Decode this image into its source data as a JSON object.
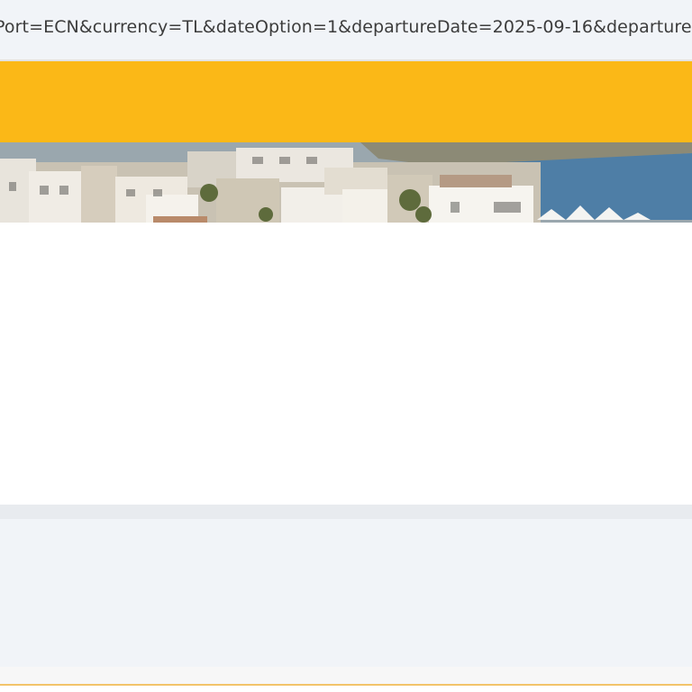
{
  "browser": {
    "url_fragment": "Port=ECN&currency=TL&dateOption=1&departureDate=2025-09-16&departurePort"
  },
  "colors": {
    "header_accent": "#fbb817",
    "page_background": "#f1f4f8"
  },
  "hero": {
    "image": "coastal-town-photo"
  }
}
